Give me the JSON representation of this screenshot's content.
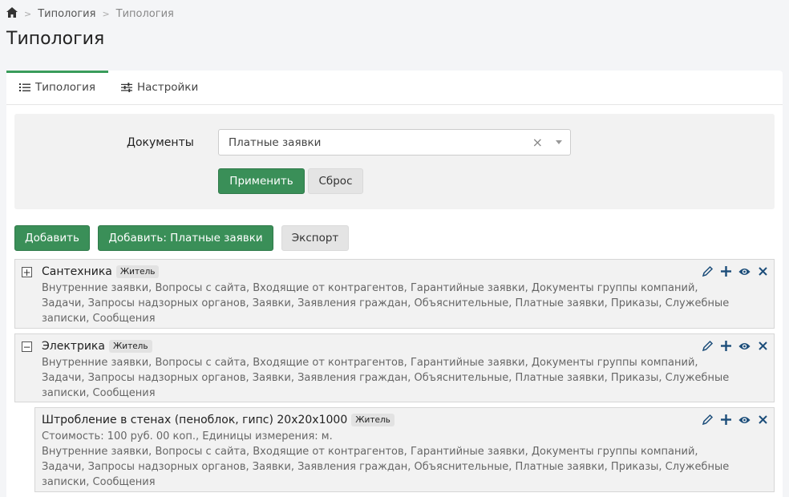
{
  "breadcrumb": {
    "items": [
      "Типология",
      "Типология"
    ],
    "separator": ">"
  },
  "page": {
    "title": "Типология"
  },
  "tabs": [
    {
      "label": "Типология",
      "icon": "list-icon",
      "active": true
    },
    {
      "label": "Настройки",
      "icon": "sliders-icon",
      "active": false
    }
  ],
  "filter": {
    "label": "Документы",
    "selected": "Платные заявки",
    "apply_label": "Применить",
    "reset_label": "Сброс"
  },
  "actions": {
    "add_label": "Добавить",
    "add_paid_label": "Добавить: Платные заявки",
    "export_label": "Экспорт"
  },
  "items": [
    {
      "title": "Сантехника",
      "badge": "Житель",
      "toggle": "+",
      "desc": "Внутренние заявки, Вопросы с сайта, Входящие от контрагентов, Гарантийные заявки, Документы группы компаний, Задачи, Запросы надзорных органов, Заявки, Заявления граждан, Объяснительные, Платные заявки, Приказы, Служебные записки, Сообщения"
    },
    {
      "title": "Электрика",
      "badge": "Житель",
      "toggle": "−",
      "desc": "Внутренние заявки, Вопросы с сайта, Входящие от контрагентов, Гарантийные заявки, Документы группы компаний, Задачи, Запросы надзорных органов, Заявки, Заявления граждан, Объяснительные, Платные заявки, Приказы, Служебные записки, Сообщения"
    },
    {
      "title": "Штробление в стенах (пеноблок, гипс) 20х20х1000",
      "badge": "Житель",
      "cost": "Стоимость: 100 руб. 00 коп., Единицы измерения: м.",
      "desc": "Внутренние заявки, Вопросы с сайта, Входящие от контрагентов, Гарантийные заявки, Документы группы компаний, Задачи, Запросы надзорных органов, Заявки, Заявления граждан, Объяснительные, Платные заявки, Приказы, Служебные записки, Сообщения"
    }
  ],
  "colors": {
    "accent": "#3a8f58",
    "tool": "#1d4e7a"
  }
}
